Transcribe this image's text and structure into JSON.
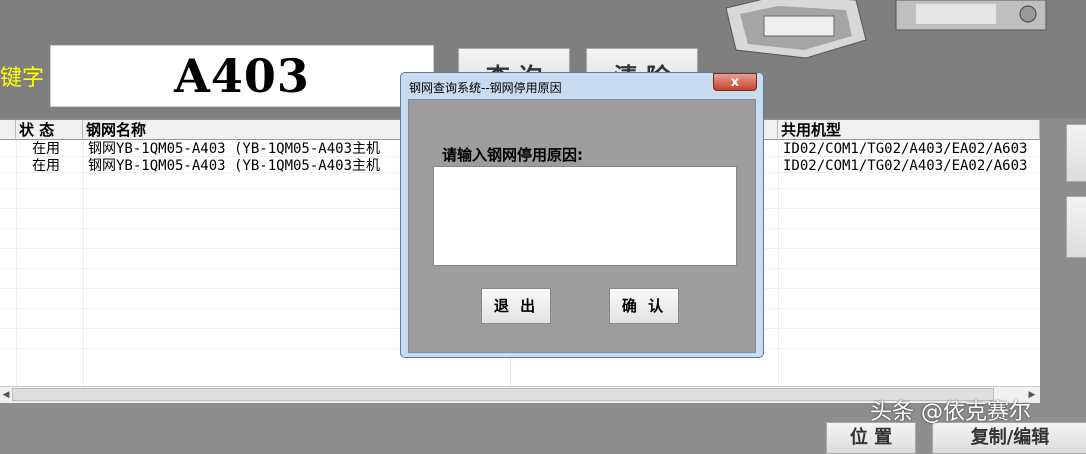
{
  "search": {
    "label": "键字",
    "value": "A403",
    "query_button": "查 询",
    "clear_button": "清 除"
  },
  "table": {
    "headers": [
      "状 态",
      "钢网名称",
      "共用机型"
    ],
    "rows": [
      {
        "status": "在用",
        "name": "钢网YB-1QM05-A403 (YB-1QM05-A403主机",
        "models": "ID02/COM1/TG02/A403/EA02/A603"
      },
      {
        "status": "在用",
        "name": "钢网YB-1QM05-A403 (YB-1QM05-A403主机",
        "models": "ID02/COM1/TG02/A403/EA02/A603"
      }
    ]
  },
  "bottom": {
    "position_button": "位 置",
    "copy_edit_button": "复制/编辑"
  },
  "watermark": "头条 @依克赛尔",
  "dialog": {
    "title": "钢网查询系统--钢网停用原因",
    "close_glyph": "x",
    "prompt": "请输入钢网停用原因:",
    "input_value": "",
    "exit_button": "退 出",
    "confirm_button": "确 认"
  },
  "colors": {
    "label_yellow": "#ffff00",
    "dialog_frame": "#c9dbef",
    "dialog_body": "#9d9d9d",
    "close_red": "#c7412b"
  }
}
